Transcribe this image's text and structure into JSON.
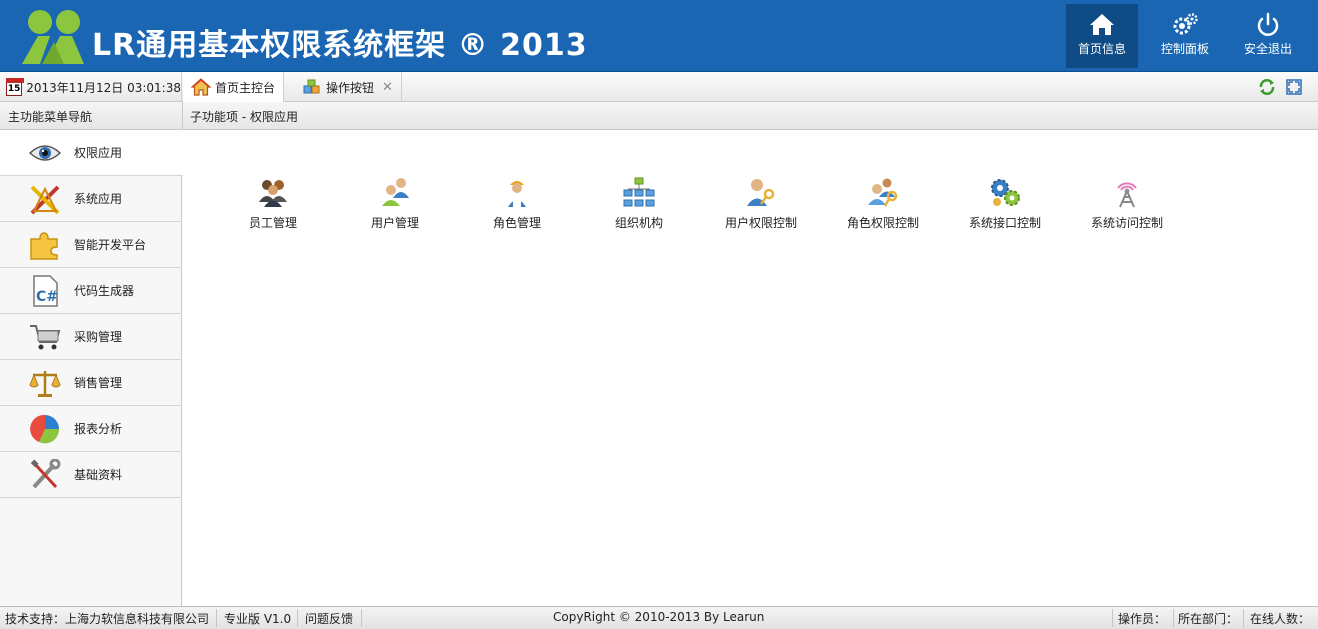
{
  "header": {
    "title": "LR通用基本权限系统框架 ® 2013",
    "buttons": [
      {
        "label": "首页信息",
        "icon": "home-icon"
      },
      {
        "label": "控制面板",
        "icon": "gear-icon"
      },
      {
        "label": "安全退出",
        "icon": "power-icon"
      }
    ]
  },
  "tabbar": {
    "datetime": "2013年11月12日 03:01:38",
    "calendar_day": "15",
    "tabs": [
      {
        "label": "首页主控台",
        "icon": "home-icon"
      },
      {
        "label": "操作按钮",
        "icon": "blocks-icon"
      }
    ]
  },
  "subheader": {
    "left": "主功能菜单导航",
    "right": "子功能项 - 权限应用"
  },
  "sidebar": {
    "items": [
      {
        "label": "权限应用",
        "icon": "eye-icon"
      },
      {
        "label": "系统应用",
        "icon": "tools-icon"
      },
      {
        "label": "智能开发平台",
        "icon": "puzzle-icon"
      },
      {
        "label": "代码生成器",
        "icon": "csharp-file-icon"
      },
      {
        "label": "采购管理",
        "icon": "cart-icon"
      },
      {
        "label": "销售管理",
        "icon": "scales-icon"
      },
      {
        "label": "报表分析",
        "icon": "pie-chart-icon"
      },
      {
        "label": "基础资料",
        "icon": "wrench-icon"
      }
    ]
  },
  "main": {
    "tiles": [
      {
        "label": "员工管理",
        "icon": "employees-icon"
      },
      {
        "label": "用户管理",
        "icon": "users-icon"
      },
      {
        "label": "角色管理",
        "icon": "worker-icon"
      },
      {
        "label": "组织机构",
        "icon": "org-chart-icon"
      },
      {
        "label": "用户权限控制",
        "icon": "user-key-icon"
      },
      {
        "label": "角色权限控制",
        "icon": "role-key-icon"
      },
      {
        "label": "系统接口控制",
        "icon": "interface-gears-icon"
      },
      {
        "label": "系统访问控制",
        "icon": "antenna-icon"
      }
    ]
  },
  "footer": {
    "support": "技术支持：上海力软信息科技有限公司",
    "edition": "专业版 V1.0",
    "feedback": "问题反馈",
    "copyright": "CopyRight © 2010-2013 By Learun",
    "operator": "操作员：",
    "department": "所在部门：",
    "online": "在线人数："
  },
  "colors": {
    "header_bg": "#1a66b3",
    "logo_green": "#8cc63f",
    "active_btn": "#0f4c86"
  }
}
